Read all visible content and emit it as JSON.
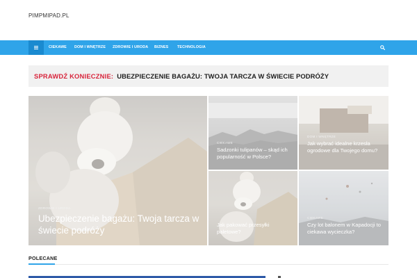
{
  "site": {
    "title": "PIMPMIPAD.PL"
  },
  "nav": {
    "items": [
      "CIEKAWE",
      "DOM I WNĘTRZE",
      "ZDROWIE I URODA",
      "BIZNES",
      "TECHNOLOGIA"
    ]
  },
  "ticker": {
    "label": "SPRAWDŹ KONIECZNIE:",
    "text": "UBEZPIECZENIE BAGAŻU: TWOJA TARCZA W ŚWIECIE PODRÓŻY"
  },
  "featured": [
    {
      "category": "ZDROWIE I URODA",
      "title": "Ubezpieczenie bagażu: Twoja tarcza w świecie podróży"
    },
    {
      "category": "CIEKAWE",
      "title": "Sadzonki tulipanów – skąd ich popularność w Polsce?"
    },
    {
      "category": "DOM I WNĘTRZE",
      "title": "Jak wybrać idealne krzesła ogrodowe dla Twojego domu?"
    },
    {
      "category": "CIEKAWE",
      "title": "Jak pakować przesyłki paletowe?"
    },
    {
      "category": "CIEKAWE",
      "title": "Czy lot balonem w Kapadocji to ciekawa wycieczka?"
    }
  ],
  "section": {
    "title": "POLECANE"
  }
}
